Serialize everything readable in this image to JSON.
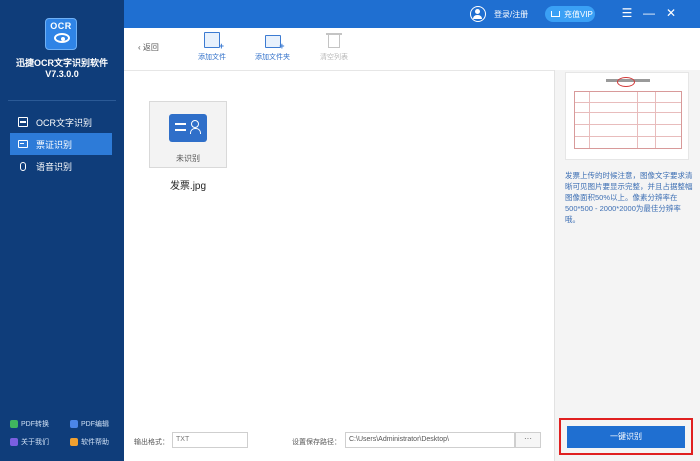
{
  "app": {
    "logo_text": "OCR",
    "name": "迅捷OCR文字识别软件",
    "version": "V7.3.0.0"
  },
  "sidebar": {
    "items": [
      {
        "label": "OCR文字识别",
        "icon": "scan-icon",
        "active": false
      },
      {
        "label": "票证识别",
        "icon": "card-icon",
        "active": true
      },
      {
        "label": "语音识别",
        "icon": "mic-icon",
        "active": false
      }
    ],
    "bottom_links": [
      {
        "label": "PDF转换",
        "icon": "pdf-convert-icon",
        "color": "#3fb55f"
      },
      {
        "label": "PDF编辑",
        "icon": "pdf-edit-icon",
        "color": "#4b86e8"
      },
      {
        "label": "关于我们",
        "icon": "about-icon",
        "color": "#7a5fe0"
      },
      {
        "label": "软件帮助",
        "icon": "help-icon",
        "color": "#f0a030"
      }
    ]
  },
  "topbar": {
    "login_label": "登录/注册",
    "vip_label": "充值VIP",
    "menu_glyph": "☰",
    "minimize_glyph": "—",
    "close_glyph": "✕"
  },
  "toolbar": {
    "back_label": "返回",
    "back_glyph": "‹",
    "add_file_label": "添加文件",
    "add_folder_label": "添加文件夹",
    "clear_list_label": "清空列表"
  },
  "file": {
    "name": "发票.jpg",
    "status": "未识别"
  },
  "settings": {
    "output_format_label": "输出格式：",
    "output_format_value": "TXT",
    "save_path_label": "设置保存路径：",
    "save_path_value": "C:\\Users\\Administrator\\Desktop\\",
    "browse_label": "···"
  },
  "right_panel": {
    "tips": "发票上传的时候注意，图像文字要求清晰可见图片要显示完整，并且占据整幅图像面积50%以上。像素分辨率在500*500 - 2000*2000为最佳分辨率哦。",
    "ocr_button_label": "一键识别"
  },
  "colors": {
    "sidebar_bg": "#0f3d7a",
    "accent": "#1f6fd1",
    "highlight_border": "#e02020"
  }
}
